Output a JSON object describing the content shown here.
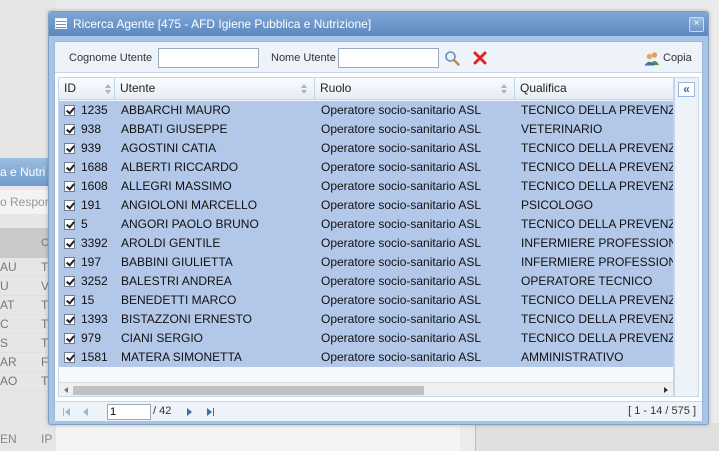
{
  "background": {
    "tab_label": "a e Nutri",
    "sub_label": "o Respor",
    "list": [
      {
        "a": "AU",
        "b": "T"
      },
      {
        "a": "U",
        "b": "V"
      },
      {
        "a": "AT",
        "b": "T"
      },
      {
        "a": "C",
        "b": "T"
      },
      {
        "a": "S",
        "b": "T"
      },
      {
        "a": "AR",
        "b": "F"
      },
      {
        "a": "AO",
        "b": "T"
      }
    ],
    "header_col2": "C",
    "bottom_a": "EN",
    "bottom_b": "IP"
  },
  "dialog": {
    "title": "Ricerca Agente [475 - AFD Igiene Pubblica e Nutrizione]",
    "close_symbol": "×",
    "toolbar": {
      "cognome_label": "Cognome Utente",
      "cognome_value": "",
      "nome_label": "Nome Utente",
      "nome_value": "",
      "copia_label": "Copia"
    },
    "columns": [
      "ID",
      "Utente",
      "Ruolo",
      "Qualifica"
    ],
    "rows": [
      {
        "id": "1235",
        "utente": "ABBARCHI MAURO",
        "ruolo": "Operatore socio-sanitario ASL",
        "qualifica": "TECNICO DELLA PREVENZ"
      },
      {
        "id": "938",
        "utente": "ABBATI GIUSEPPE",
        "ruolo": "Operatore socio-sanitario ASL",
        "qualifica": "VETERINARIO"
      },
      {
        "id": "939",
        "utente": "AGOSTINI CATIA",
        "ruolo": "Operatore socio-sanitario ASL",
        "qualifica": "TECNICO DELLA PREVENZ"
      },
      {
        "id": "1688",
        "utente": "ALBERTI RICCARDO",
        "ruolo": "Operatore socio-sanitario ASL",
        "qualifica": "TECNICO DELLA PREVENZ"
      },
      {
        "id": "1608",
        "utente": "ALLEGRI MASSIMO",
        "ruolo": "Operatore socio-sanitario ASL",
        "qualifica": "TECNICO DELLA PREVENZ"
      },
      {
        "id": "191",
        "utente": "ANGIOLONI MARCELLO",
        "ruolo": "Operatore socio-sanitario ASL",
        "qualifica": "PSICOLOGO"
      },
      {
        "id": "5",
        "utente": "ANGORI PAOLO BRUNO",
        "ruolo": "Operatore socio-sanitario ASL",
        "qualifica": "TECNICO DELLA PREVENZ"
      },
      {
        "id": "3392",
        "utente": "AROLDI GENTILE",
        "ruolo": "Operatore socio-sanitario ASL",
        "qualifica": "INFERMIERE PROFESSION"
      },
      {
        "id": "197",
        "utente": "BABBINI GIULIETTA",
        "ruolo": "Operatore socio-sanitario ASL",
        "qualifica": "INFERMIERE PROFESSION"
      },
      {
        "id": "3252",
        "utente": "BALESTRI ANDREA",
        "ruolo": "Operatore socio-sanitario ASL",
        "qualifica": "OPERATORE TECNICO"
      },
      {
        "id": "15",
        "utente": "BENEDETTI MARCO",
        "ruolo": "Operatore socio-sanitario ASL",
        "qualifica": "TECNICO DELLA PREVENZ"
      },
      {
        "id": "1393",
        "utente": "BISTAZZONI ERNESTO",
        "ruolo": "Operatore socio-sanitario ASL",
        "qualifica": "TECNICO DELLA PREVENZ"
      },
      {
        "id": "979",
        "utente": "CIANI SERGIO",
        "ruolo": "Operatore socio-sanitario ASL",
        "qualifica": "TECNICO DELLA PREVENZ"
      },
      {
        "id": "1581",
        "utente": "MATERA SIMONETTA",
        "ruolo": "Operatore socio-sanitario ASL",
        "qualifica": "AMMINISTRATIVO"
      }
    ],
    "pager": {
      "page": "1",
      "total_pages": "/ 42",
      "range": "[ 1 - 14 / 575 ]"
    }
  }
}
